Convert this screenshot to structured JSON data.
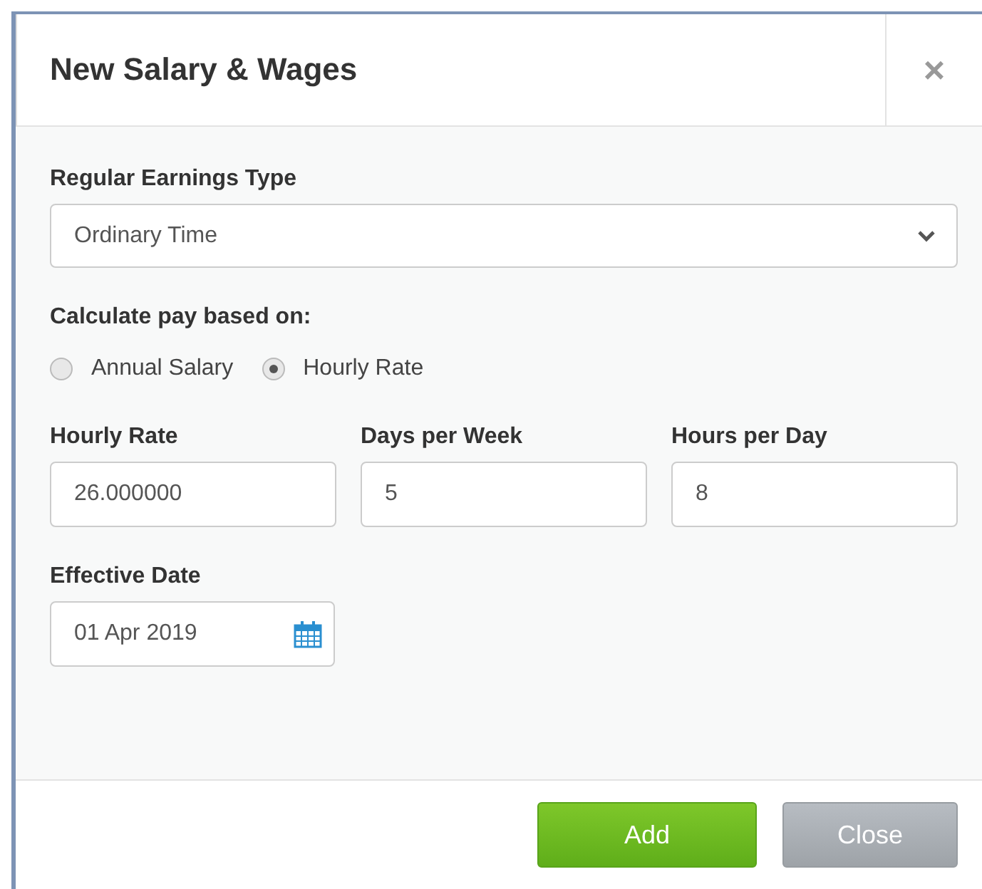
{
  "dialog": {
    "title": "New Salary & Wages",
    "close_glyph": "×"
  },
  "earnings_type": {
    "label": "Regular Earnings Type",
    "value": "Ordinary Time"
  },
  "pay_basis": {
    "label": "Calculate pay based on:",
    "options": [
      {
        "label": "Annual Salary",
        "selected": false
      },
      {
        "label": "Hourly Rate",
        "selected": true
      }
    ]
  },
  "fields": [
    {
      "label": "Hourly Rate",
      "value": "26.000000"
    },
    {
      "label": "Days per Week",
      "value": "5"
    },
    {
      "label": "Hours per Day",
      "value": "8"
    }
  ],
  "effective_date": {
    "label": "Effective Date",
    "value": "01 Apr 2019"
  },
  "buttons": [
    {
      "label": "Add",
      "kind": "primary"
    },
    {
      "label": "Close",
      "kind": "secondary"
    }
  ]
}
